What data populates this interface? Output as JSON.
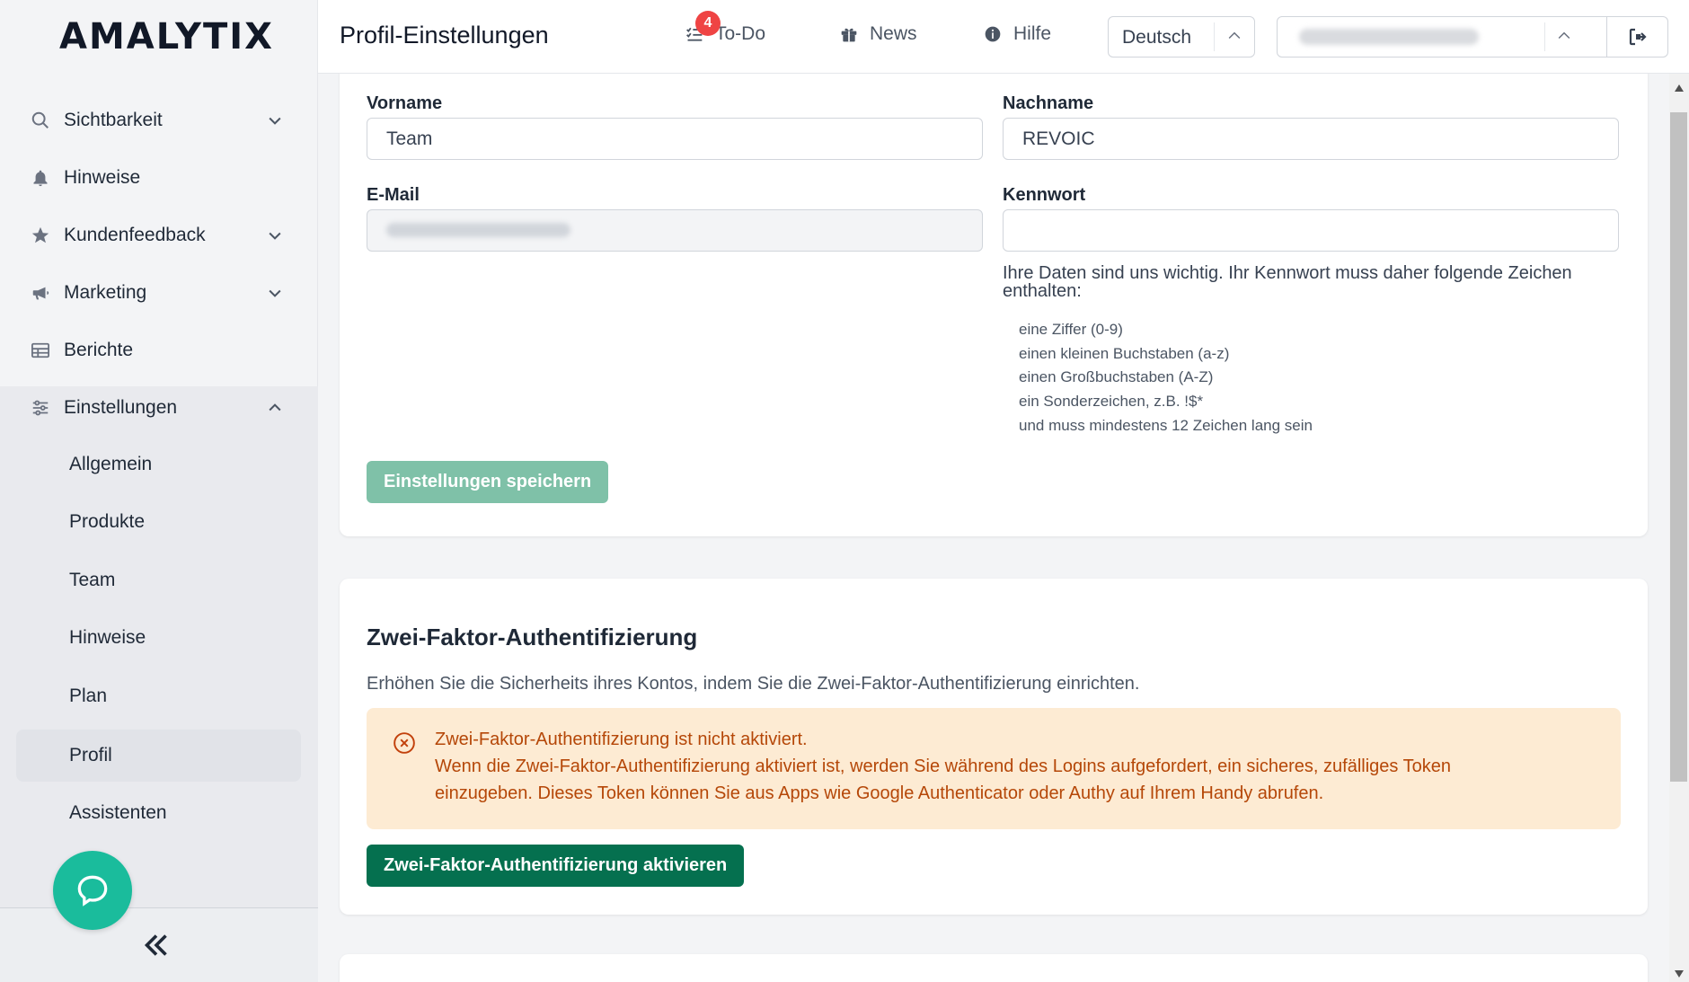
{
  "app": {
    "logo": "AMALYTIX"
  },
  "sidebar": {
    "items": [
      {
        "label": "Sichtbarkeit",
        "icon": "search-icon",
        "expandable": true
      },
      {
        "label": "Hinweise",
        "icon": "bell-icon",
        "expandable": false
      },
      {
        "label": "Kundenfeedback",
        "icon": "star-icon",
        "expandable": true
      },
      {
        "label": "Marketing",
        "icon": "megaphone-icon",
        "expandable": true
      },
      {
        "label": "Berichte",
        "icon": "table-icon",
        "expandable": false
      },
      {
        "label": "Einstellungen",
        "icon": "sliders-icon",
        "expanded": true
      }
    ],
    "sub_items": [
      "Allgemein",
      "Produkte",
      "Team",
      "Hinweise",
      "Plan",
      "Profil",
      "Assistenten"
    ],
    "active_sub": "Profil"
  },
  "header": {
    "title": "Profil-Einstellungen",
    "todo_label": "To-Do",
    "todo_count": "4",
    "news_label": "News",
    "help_label": "Hilfe",
    "language": "Deutsch"
  },
  "profile_form": {
    "firstname_label": "Vorname",
    "firstname_value": "Team",
    "lastname_label": "Nachname",
    "lastname_value": "REVOIC",
    "email_label": "E-Mail",
    "password_label": "Kennwort",
    "password_hint": "Ihre Daten sind uns wichtig. Ihr Kennwort muss daher folgende Zeichen enthalten:",
    "password_rules": [
      "eine Ziffer (0-9)",
      "einen kleinen Buchstaben (a-z)",
      "einen Großbuchstaben (A-Z)",
      "ein Sonderzeichen, z.B. !$*",
      "und muss mindestens 12 Zeichen lang sein"
    ],
    "save_label": "Einstellungen speichern"
  },
  "two_factor": {
    "title": "Zwei-Faktor-Authentifizierung",
    "description": "Erhöhen Sie die Sicherheits ihres Kontos, indem Sie die Zwei-Faktor-Authentifizierung einrichten.",
    "alert_line1": "Zwei-Faktor-Authentifizierung ist nicht aktiviert.",
    "alert_line2": "Wenn die Zwei-Faktor-Authentifizierung aktiviert ist, werden Sie während des Logins aufgefordert, ein sicheres, zufälliges Token",
    "alert_line3": "einzugeben. Dieses Token können Sie aus Apps wie Google Authenticator oder Authy auf Ihrem Handy abrufen.",
    "activate_label": "Zwei-Faktor-Authentifizierung aktivieren"
  },
  "colors": {
    "accent": "#05704f",
    "accent_disabled": "#7fc1a8",
    "alert_bg": "#fdebd3",
    "alert_text": "#b54708",
    "badge": "#ef4444",
    "chat": "#1abc9c"
  }
}
